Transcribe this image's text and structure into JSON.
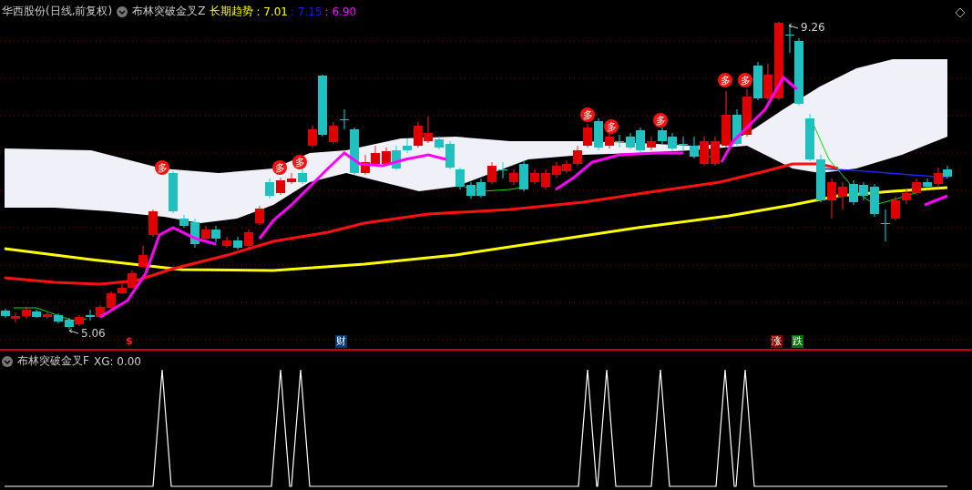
{
  "header": {
    "security": "华西股份(日线,前复权)",
    "indicator": "布林突破金叉Z",
    "trend_label": "长期趋势",
    "values": [
      {
        "text": ": 7.01",
        "color": "#ffff00"
      },
      {
        "text": ": 7.15",
        "color": "#1a1aff"
      },
      {
        "text": ": 6.90",
        "color": "#ff00ff"
      }
    ]
  },
  "price_labels": {
    "high": "9.26",
    "low": "5.06"
  },
  "signals": [
    {
      "label": "多"
    },
    {
      "label": "多"
    },
    {
      "label": "多"
    },
    {
      "label": "多"
    },
    {
      "label": "多"
    },
    {
      "label": "多"
    },
    {
      "label": "多"
    },
    {
      "label": "多"
    }
  ],
  "event_markers": [
    {
      "label": "$",
      "kind": "dollar"
    },
    {
      "label": "财",
      "kind": "finance"
    },
    {
      "label": "涨",
      "kind": "up"
    },
    {
      "label": "跌",
      "kind": "down"
    }
  ],
  "lower_panel": {
    "indicator": "布林突破金叉F",
    "reading": "XG: 0.00"
  }
}
